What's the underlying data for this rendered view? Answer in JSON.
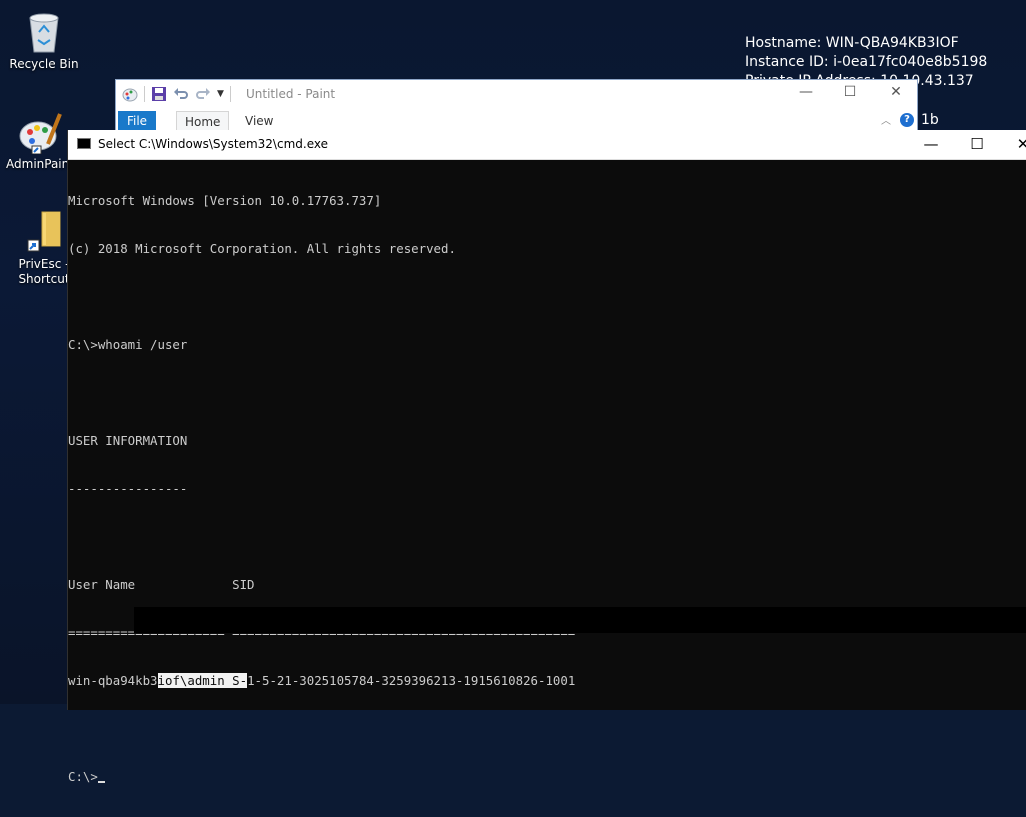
{
  "desktop": {
    "info_lines": [
      "Hostname: WIN-QBA94KB3IOF",
      "Instance ID: i-0ea17fc040e8b5198",
      "Private IP Address: 10.10.43.137"
    ],
    "icons": [
      {
        "label": "Recycle Bin",
        "icon": "recycle-bin-icon"
      },
      {
        "label": "AdminPaint",
        "icon": "paint-icon"
      },
      {
        "label": "PrivEsc - Shortcut",
        "icon": "folder-icon"
      }
    ]
  },
  "paint": {
    "title": "Untitled - Paint",
    "tabs": [
      "File",
      "Home",
      "View"
    ],
    "minimize": "—",
    "maximize": "☐",
    "close": "✕",
    "help": "?",
    "partial_right_text": "1b"
  },
  "cmd": {
    "title": "Select C:\\Windows\\System32\\cmd.exe",
    "minimize": "—",
    "maximize": "☐",
    "close": "✕",
    "lines": [
      "Microsoft Windows [Version 10.0.17763.737]",
      "(c) 2018 Microsoft Corporation. All rights reserved.",
      "",
      "C:\\>whoami /user",
      "",
      "USER INFORMATION",
      "----------------",
      "",
      "User Name             SID",
      "===================== ==============================================",
      "",
      "",
      "C:\\>"
    ],
    "user_row": {
      "before": "win-qba94kb3",
      "selected": "iof\\admin S-",
      "after": "1-5-21-3025105784-3259396213-1915610826-1001"
    }
  },
  "colors": {
    "console_bg": "#0c0c0c",
    "console_text": "#cccccc",
    "paint_file_tab": "#1979ca"
  }
}
